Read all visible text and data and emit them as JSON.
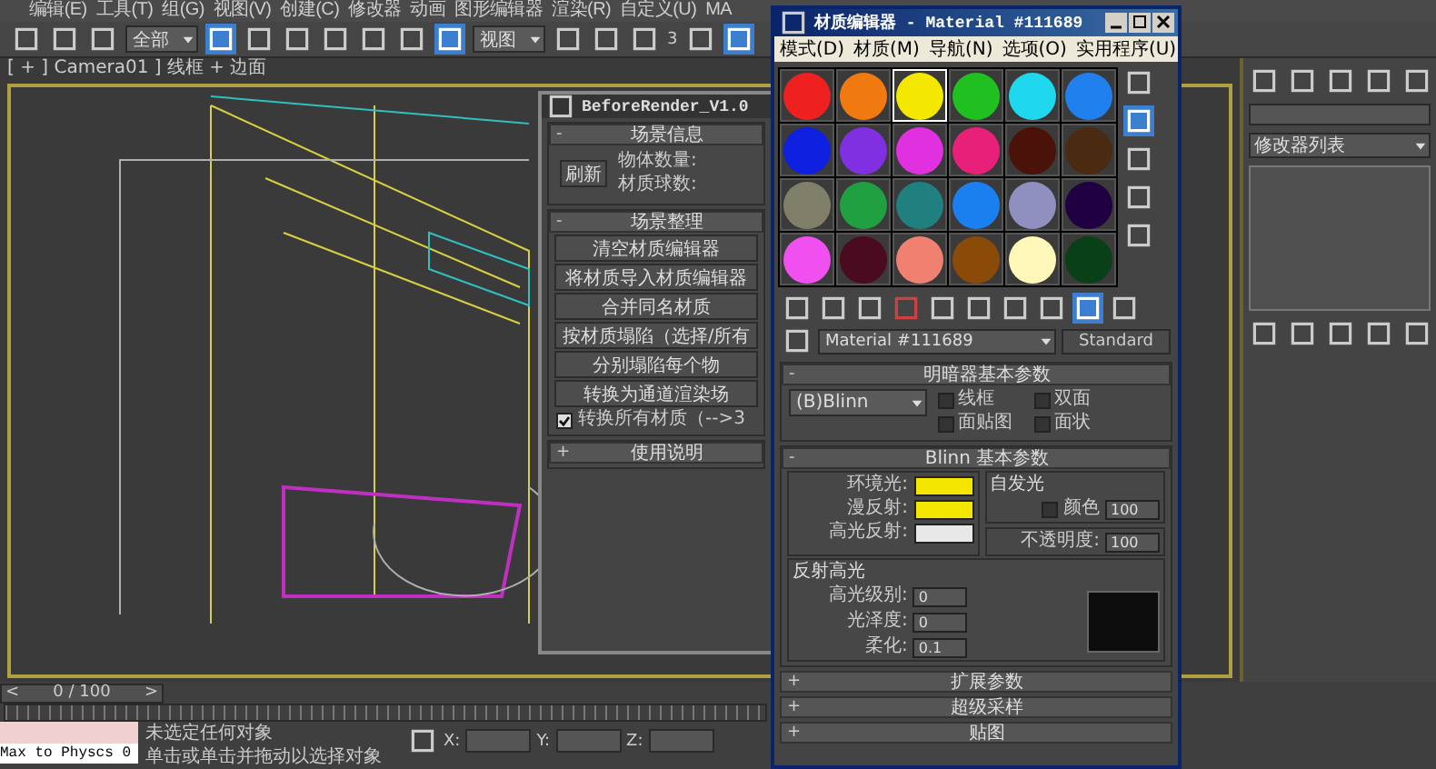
{
  "menu_bar": {
    "items": [
      "编辑(E)",
      "工具(T)",
      "组(G)",
      "视图(V)",
      "创建(C)",
      "修改器",
      "动画",
      "图形编辑器",
      "渲染(R)",
      "自定义(U)",
      "MA"
    ]
  },
  "toolbar": {
    "selection_filter": "全部",
    "reference_coord": "视图",
    "snap_label": "3"
  },
  "viewport": {
    "label": "[ + ] Camera01 ] 线框 + 边面"
  },
  "before_render": {
    "title": "BeforeRender_V1.0",
    "scene_info": {
      "header": "场景信息",
      "toggle": "-",
      "refresh_button": "刷新",
      "labels": [
        "物体数量:",
        "材质球数:"
      ]
    },
    "scene_cleanup": {
      "header": "场景整理",
      "toggle": "-",
      "buttons": [
        "清空材质编辑器",
        "将材质导入材质编辑器",
        "合并同名材质",
        "按材质塌陷（选择/所有",
        "分别塌陷每个物",
        "转换为通道渲染场"
      ],
      "checkbox": {
        "label": "转换所有材质（-->3",
        "checked": true
      }
    },
    "help": {
      "header": "使用说明",
      "toggle": "+"
    }
  },
  "material_editor": {
    "title": "材质编辑器 - Material #111689",
    "menu": [
      "模式(D)",
      "材质(M)",
      "导航(N)",
      "选项(O)",
      "实用程序(U)"
    ],
    "slots": [
      {
        "color": "#ee2020",
        "selected": false
      },
      {
        "color": "#f07a10",
        "selected": false
      },
      {
        "color": "#f5e800",
        "selected": true
      },
      {
        "color": "#20c020",
        "selected": false
      },
      {
        "color": "#20d8ee",
        "selected": false
      },
      {
        "color": "#2080ee",
        "selected": false
      },
      {
        "color": "#1020e0",
        "selected": false
      },
      {
        "color": "#8030e0",
        "selected": false
      },
      {
        "color": "#e030e0",
        "selected": false
      },
      {
        "color": "#e8207a",
        "selected": false
      },
      {
        "color": "#4a1208",
        "selected": false
      },
      {
        "color": "#4a2a10",
        "selected": false
      },
      {
        "color": "#80806a",
        "selected": false
      },
      {
        "color": "#20a040",
        "selected": false
      },
      {
        "color": "#208080",
        "selected": false
      },
      {
        "color": "#1a80f0",
        "selected": false
      },
      {
        "color": "#9090c0",
        "selected": false
      },
      {
        "color": "#200040",
        "selected": false
      },
      {
        "color": "#f050f0",
        "selected": false
      },
      {
        "color": "#4a0a20",
        "selected": false
      },
      {
        "color": "#f08070",
        "selected": false
      },
      {
        "color": "#8a4a08",
        "selected": false
      },
      {
        "color": "#fff8b8",
        "selected": false
      },
      {
        "color": "#0a4018",
        "selected": false
      }
    ],
    "material_name": "Material #111689",
    "material_type": "Standard",
    "shader_rollout": {
      "header": "明暗器基本参数",
      "toggle": "-",
      "shader": "(B)Blinn",
      "options": [
        {
          "label": "线框",
          "checked": false
        },
        {
          "label": "双面",
          "checked": false
        },
        {
          "label": "面贴图",
          "checked": false
        },
        {
          "label": "面状",
          "checked": false
        }
      ]
    },
    "blinn_rollout": {
      "header": "Blinn 基本参数",
      "toggle": "-",
      "colors": [
        {
          "label": "环境光:",
          "color": "#f5e600"
        },
        {
          "label": "漫反射:",
          "color": "#f5e600"
        },
        {
          "label": "高光反射:",
          "color": "#e8e8e8"
        }
      ],
      "self_illum": {
        "title": "自发光",
        "checkbox": {
          "label": "颜色",
          "checked": false
        },
        "value": "100"
      },
      "opacity": {
        "label": "不透明度:",
        "value": "100"
      },
      "highlights": {
        "title": "反射高光",
        "fields": [
          {
            "label": "高光级别:",
            "value": "0"
          },
          {
            "label": "光泽度:",
            "value": "0"
          },
          {
            "label": "柔化:",
            "value": "0.1"
          }
        ]
      }
    },
    "collapsed_rollouts": [
      {
        "header": "扩展参数",
        "toggle": "+"
      },
      {
        "header": "超级采样",
        "toggle": "+"
      },
      {
        "header": "贴图",
        "toggle": "+"
      }
    ]
  },
  "command_panel": {
    "modifier_list": "修改器列表"
  },
  "timeline": {
    "prev": "<",
    "frame": "0 / 100",
    "next": ">"
  },
  "status_bar": {
    "script_listener": "Max to Physcs 0",
    "status": "未选定任何对象",
    "prompt": "单击或单击并拖动以选择对象",
    "axes": [
      "X:",
      "Y:",
      "Z:"
    ]
  }
}
